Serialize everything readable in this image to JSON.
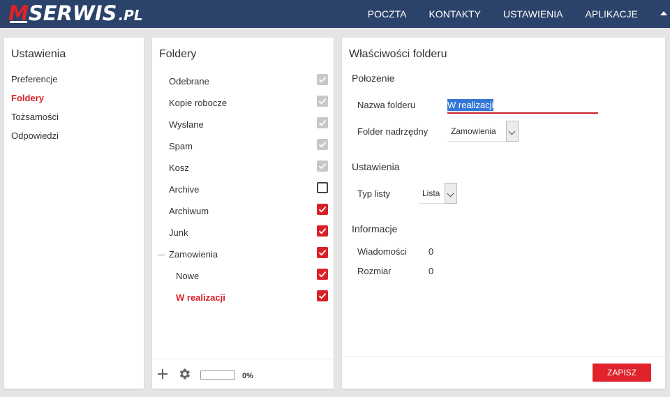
{
  "brand": {
    "logo_m": "M",
    "logo_main": "SERWIS",
    "logo_tld": ".PL"
  },
  "topnav": {
    "items": [
      "POCZTA",
      "KONTAKTY",
      "USTAWIENIA",
      "APLIKACJE"
    ]
  },
  "settings": {
    "title": "Ustawienia",
    "items": [
      "Preferencje",
      "Foldery",
      "Tożsamości",
      "Odpowiedzi"
    ],
    "active": "Foldery"
  },
  "folders": {
    "title": "Foldery",
    "items": [
      {
        "name": "Odebrane",
        "subscribed": true,
        "disabled": true
      },
      {
        "name": "Kopie robocze",
        "subscribed": true,
        "disabled": true
      },
      {
        "name": "Wysłane",
        "subscribed": true,
        "disabled": true
      },
      {
        "name": "Spam",
        "subscribed": true,
        "disabled": true
      },
      {
        "name": "Kosz",
        "subscribed": true,
        "disabled": true
      },
      {
        "name": "Archive",
        "subscribed": false,
        "disabled": false
      },
      {
        "name": "Archiwum",
        "subscribed": true,
        "disabled": false
      },
      {
        "name": "Junk",
        "subscribed": true,
        "disabled": false
      },
      {
        "name": "Zamowienia",
        "subscribed": true,
        "disabled": false,
        "expanded": true
      },
      {
        "name": "Nowe",
        "subscribed": true,
        "disabled": false,
        "child": true
      },
      {
        "name": "W realizacji",
        "subscribed": true,
        "disabled": false,
        "child": true,
        "active": true
      }
    ],
    "quota_fraction": 0,
    "quota_text": "0%"
  },
  "properties": {
    "title": "Właściwości folderu",
    "location_heading": "Położenie",
    "name_label": "Nazwa folderu",
    "name_value": "W realizacji",
    "parent_label": "Folder nadrzędny",
    "parent_value": "Zamowienia",
    "settings_heading": "Ustawienia",
    "listtype_label": "Typ listy",
    "listtype_value": "Lista",
    "info_heading": "Informacje",
    "messages_label": "Wiadomości",
    "messages_value": "0",
    "size_label": "Rozmiar",
    "size_value": "0",
    "save_label": "ZAPISZ"
  },
  "colors": {
    "accent": "#e0222a",
    "navbar": "#2b426a",
    "disabled_checkbox": "#c8c8c8",
    "selection": "#3478d6"
  },
  "icons": {
    "add": "plus-icon",
    "actions": "gear-icon",
    "collapse": "collapse-icon",
    "menu": "caret-up-icon"
  }
}
